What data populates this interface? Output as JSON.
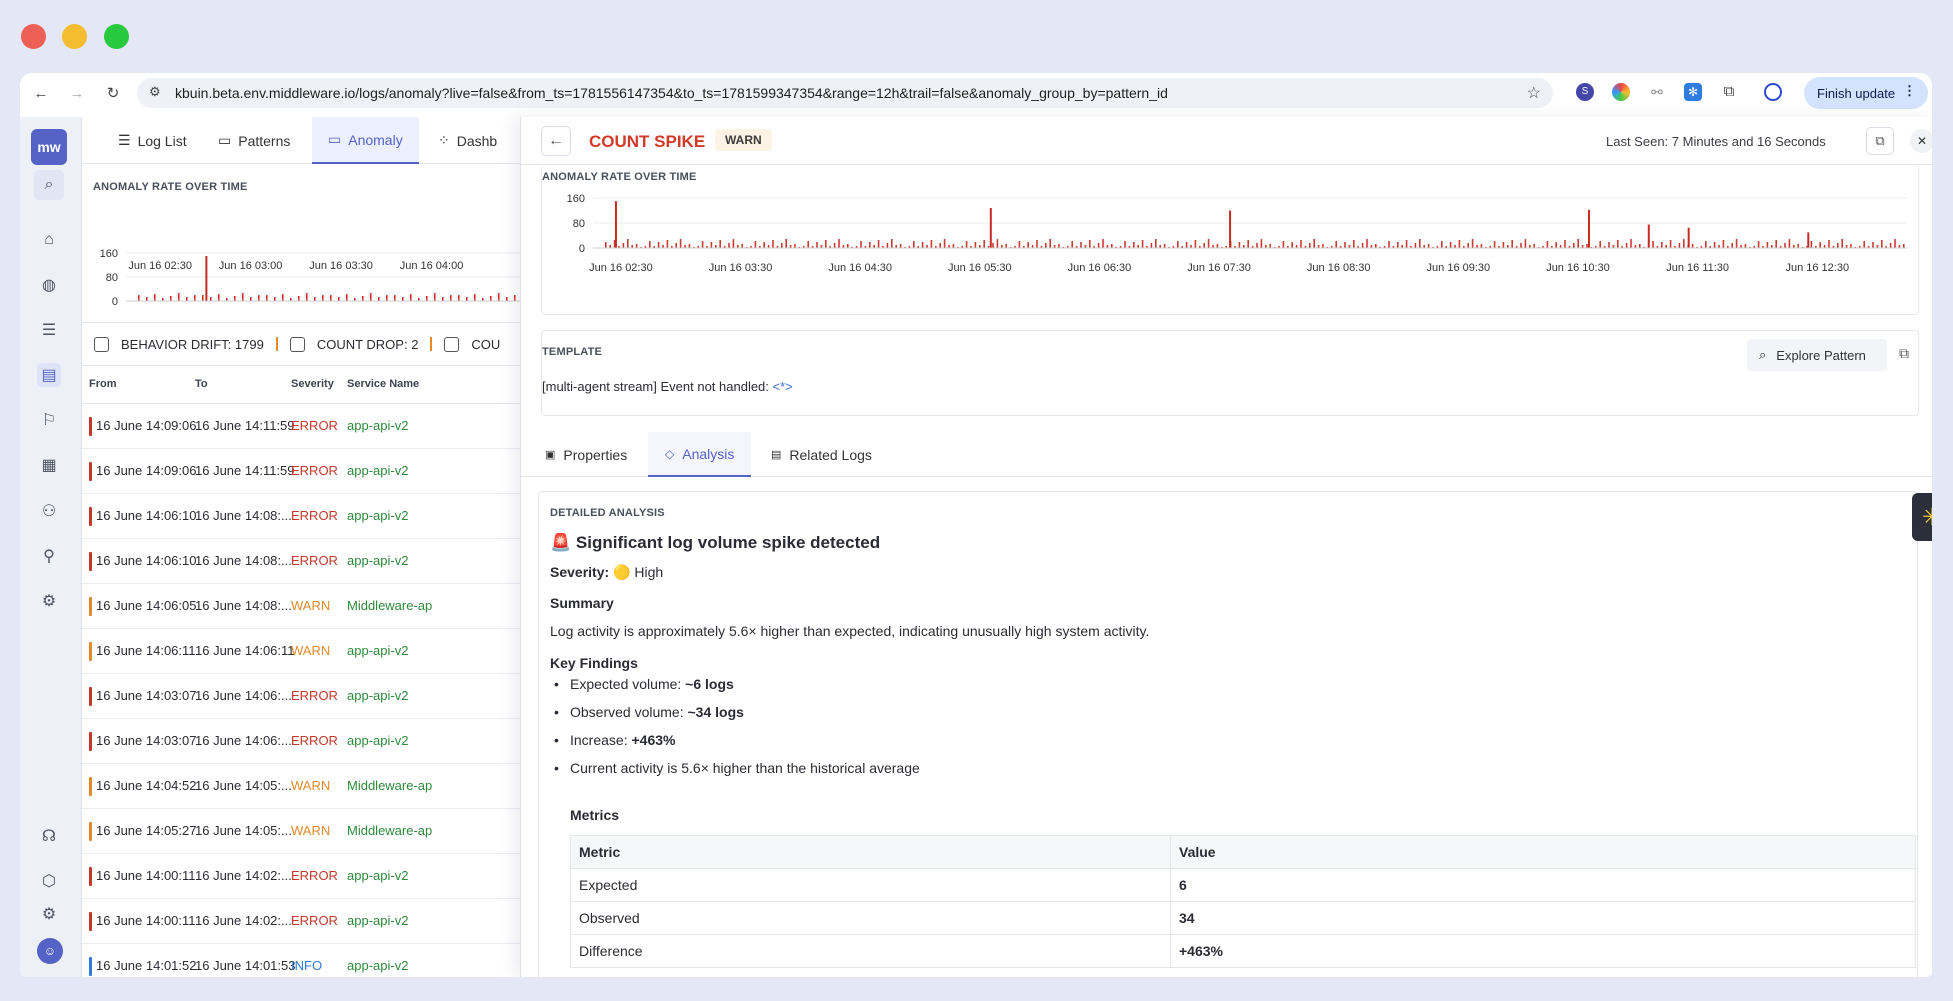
{
  "browser": {
    "url": "kbuin.beta.env.middleware.io/logs/anomaly?live=false&from_ts=1781556147354&to_ts=1781599347354&range=12h&trail=false&anomaly_group_by=pattern_id",
    "finish_update": "Finish update",
    "traffic_colors": [
      "#ee5f55",
      "#f4bd2f",
      "#27c93f"
    ]
  },
  "app": {
    "logo": "mw",
    "avatar_initial": "☺"
  },
  "nav": {
    "tabs": [
      {
        "label": "Log List",
        "icon": "list-icon"
      },
      {
        "label": "Patterns",
        "icon": "patterns-icon"
      },
      {
        "label": "Anomaly",
        "icon": "anomaly-icon"
      },
      {
        "label": "Dashb",
        "icon": "dashboard-icon"
      }
    ]
  },
  "left": {
    "chart_title": "ANOMALY RATE OVER TIME",
    "filters": {
      "behavior_drift": "BEHAVIOR DRIFT: 1799",
      "count_drop": "COUNT DROP: 2",
      "third": "COU"
    },
    "columns": {
      "from": "From",
      "to": "To",
      "severity": "Severity",
      "service": "Service Name"
    },
    "rows": [
      {
        "from": "16 June 14:09:06",
        "to": "16 June 14:11:59",
        "severity": "ERROR",
        "service": "app-api-v2"
      },
      {
        "from": "16 June 14:09:06",
        "to": "16 June 14:11:59",
        "severity": "ERROR",
        "service": "app-api-v2"
      },
      {
        "from": "16 June 14:06:10",
        "to": "16 June 14:08:...",
        "severity": "ERROR",
        "service": "app-api-v2"
      },
      {
        "from": "16 June 14:06:10",
        "to": "16 June 14:08:...",
        "severity": "ERROR",
        "service": "app-api-v2"
      },
      {
        "from": "16 June 14:06:05",
        "to": "16 June 14:08:...",
        "severity": "WARN",
        "service": "Middleware-ap"
      },
      {
        "from": "16 June 14:06:11",
        "to": "16 June 14:06:11",
        "severity": "WARN",
        "service": "app-api-v2"
      },
      {
        "from": "16 June 14:03:07",
        "to": "16 June 14:06:...",
        "severity": "ERROR",
        "service": "app-api-v2"
      },
      {
        "from": "16 June 14:03:07",
        "to": "16 June 14:06:...",
        "severity": "ERROR",
        "service": "app-api-v2"
      },
      {
        "from": "16 June 14:04:52",
        "to": "16 June 14:05:...",
        "severity": "WARN",
        "service": "Middleware-ap"
      },
      {
        "from": "16 June 14:05:27",
        "to": "16 June 14:05:...",
        "severity": "WARN",
        "service": "Middleware-ap"
      },
      {
        "from": "16 June 14:00:11",
        "to": "16 June 14:02:...",
        "severity": "ERROR",
        "service": "app-api-v2"
      },
      {
        "from": "16 June 14:00:11",
        "to": "16 June 14:02:...",
        "severity": "ERROR",
        "service": "app-api-v2"
      },
      {
        "from": "16 June 14:01:52",
        "to": "16 June 14:01:53",
        "severity": "INFO",
        "service": "app-api-v2"
      }
    ]
  },
  "detail": {
    "title": "COUNT SPIKE",
    "badge": "WARN",
    "last_seen": "Last Seen: 7 Minutes and 16 Seconds",
    "chart_title": "ANOMALY RATE OVER TIME",
    "template_label": "TEMPLATE",
    "template_text": "[multi-agent stream] Event not handled: ",
    "template_token": "<*>",
    "explore": "Explore Pattern",
    "tabs": [
      "Properties",
      "Analysis",
      "Related Logs"
    ],
    "analysis": {
      "section": "DETAILED ANALYSIS",
      "headline_emoji": "🚨",
      "headline": "Significant log volume spike detected",
      "severity_label": "Severity:",
      "severity_emoji": "🟡",
      "severity_value": "High",
      "summary_h": "Summary",
      "summary": "Log activity is approximately 5.6× higher than expected, indicating unusually high system activity.",
      "findings_h": "Key Findings",
      "findings": [
        {
          "label": "Expected volume: ",
          "value": "~6 logs"
        },
        {
          "label": "Observed volume: ",
          "value": "~34 logs"
        },
        {
          "label": "Increase: ",
          "value": "+463%"
        },
        {
          "label": "Current activity is 5.6× higher than the historical average",
          "value": ""
        }
      ],
      "metrics_h": "Metrics",
      "metrics_cols": [
        "Metric",
        "Value"
      ],
      "metrics_rows": [
        [
          "Expected",
          "6"
        ],
        [
          "Observed",
          "34"
        ],
        [
          "Difference",
          "+463%"
        ]
      ]
    }
  },
  "chart_data": [
    {
      "type": "bar",
      "title": "ANOMALY RATE OVER TIME",
      "yticks": [
        160,
        80,
        0
      ],
      "ylim": [
        0,
        160
      ],
      "xticks": [
        "Jun 16 02:30",
        "Jun 16 03:00",
        "Jun 16 03:30",
        "Jun 16 04:00"
      ],
      "spikes": [
        {
          "x": "Jun 16 02:45",
          "y": 150
        }
      ],
      "baseline": 22
    },
    {
      "type": "bar",
      "title": "ANOMALY RATE OVER TIME",
      "yticks": [
        160,
        80,
        0
      ],
      "ylim": [
        0,
        160
      ],
      "xticks": [
        "Jun 16 02:30",
        "Jun 16 03:30",
        "Jun 16 04:30",
        "Jun 16 05:30",
        "Jun 16 06:30",
        "Jun 16 07:30",
        "Jun 16 08:30",
        "Jun 16 09:30",
        "Jun 16 10:30",
        "Jun 16 11:30",
        "Jun 16 12:30"
      ],
      "spikes": [
        {
          "x": "Jun 16 02:27",
          "y": 150
        },
        {
          "x": "Jun 16 05:35",
          "y": 128
        },
        {
          "x": "Jun 16 07:35",
          "y": 120
        },
        {
          "x": "Jun 16 10:35",
          "y": 122
        },
        {
          "x": "Jun 16 11:05",
          "y": 75
        },
        {
          "x": "Jun 16 11:25",
          "y": 65
        },
        {
          "x": "Jun 16 12:25",
          "y": 50
        }
      ]
    }
  ]
}
